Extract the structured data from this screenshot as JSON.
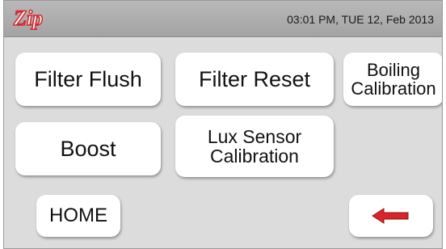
{
  "header": {
    "brand": "Zip",
    "datetime": "03:01 PM, TUE 12, Feb 2013"
  },
  "buttons": {
    "filter_flush": "Filter Flush",
    "filter_reset": "Filter Reset",
    "boiling_calibration": "Boiling\nCalibration",
    "boost": "Boost",
    "lux_sensor_calibration": "Lux Sensor\nCalibration",
    "home": "HOME"
  },
  "icons": {
    "back": "left-arrow-icon"
  },
  "colors": {
    "brand_red": "#d8242b",
    "arrow_red": "#d8242b"
  }
}
